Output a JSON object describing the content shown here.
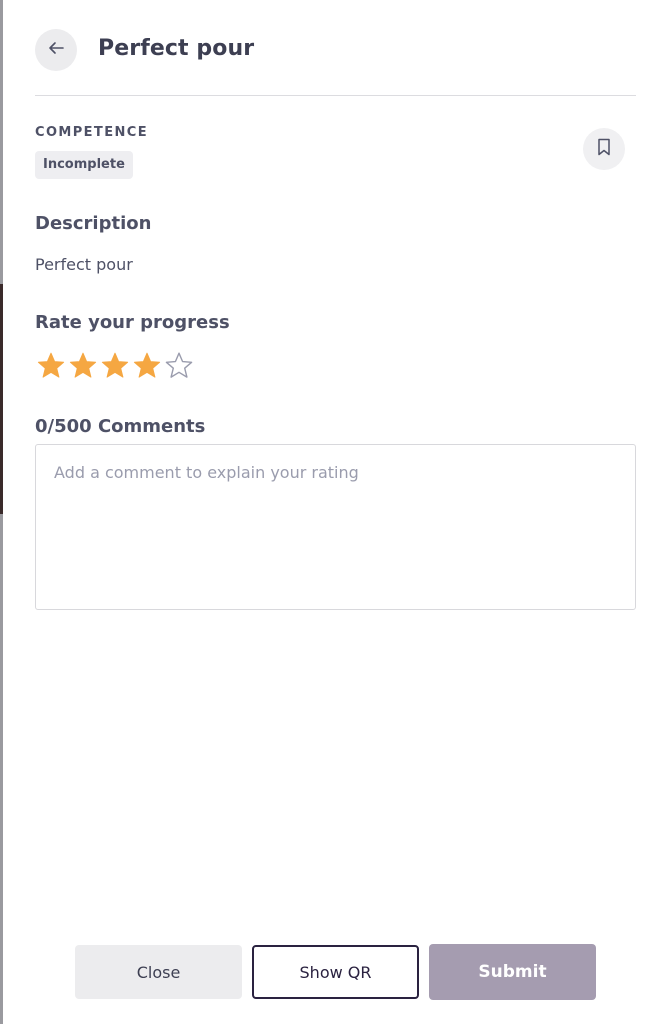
{
  "header": {
    "title": "Perfect pour",
    "back_icon": "arrow-left-icon"
  },
  "competence": {
    "category_label": "COMPETENCE",
    "status": "Incomplete",
    "bookmark_icon": "bookmark-icon"
  },
  "description": {
    "heading": "Description",
    "text": "Perfect pour"
  },
  "rating": {
    "heading": "Rate your progress",
    "value": 4,
    "max": 5,
    "filled_color": "#f5a742",
    "empty_color": "#9a9cad"
  },
  "comments": {
    "heading": "0/500 Comments",
    "value": "",
    "placeholder": "Add a comment to explain your rating"
  },
  "footer": {
    "close_label": "Close",
    "show_qr_label": "Show QR",
    "submit_label": "Submit"
  },
  "colors": {
    "text_primary": "#4e5166",
    "title": "#3d3f52",
    "submit_disabled_bg": "#a59cb0",
    "qr_border": "#2a2240"
  }
}
